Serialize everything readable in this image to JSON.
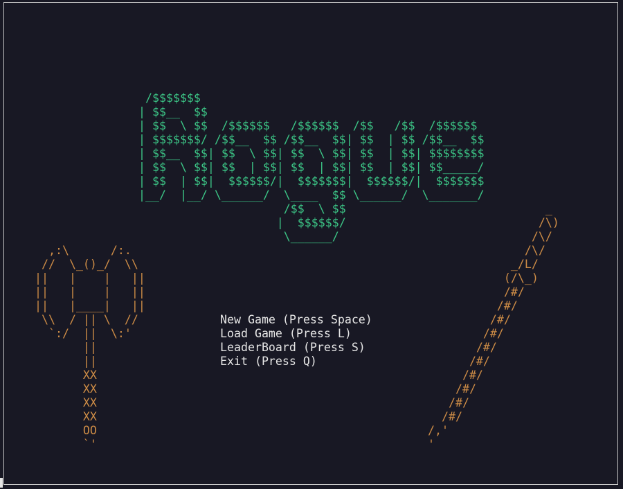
{
  "game": {
    "logo_art": " /$$$$$$$\n| $$__  $$\n| $$  \\ $$  /$$$$$$   /$$$$$$  /$$   /$$  /$$$$$$\n| $$$$$$$/ /$$__  $$ /$$__  $$| $$  | $$ /$$__  $$\n| $$__  $$| $$  \\ $$| $$  \\ $$| $$  | $$| $$$$$$$$\n| $$  \\ $$| $$  | $$| $$  | $$| $$  | $$| $$_____/\n| $$  | $$|  $$$$$$/|  $$$$$$$|  $$$$$$/|  $$$$$$$\n|__/  |__/ \\______/  \\____  $$ \\______/  \\_______/\n                     /$$  \\ $$\n                    |  $$$$$$/\n                     \\______/",
    "axe_art": "  ,:\\      /:.\n //  \\_()_/  \\\\\n||   |    |   ||\n||   |    |   ||\n||   |____|   ||\n \\\\  / || \\  //\n  `:/  ||  \\:'\n       ||\n       ||\n       XX\n       XX\n       XX\n       XX\n       OO\n       `'",
    "staff_art": "                 _\n                /\\)\n               /\\/\n              /\\/\n            _/L/\n           (/\\_)\n           /#/\n          /#/\n         /#/\n        /#/\n       /#/\n      /#/\n     /#/\n    /#/\n   /#/\n  /#/\n/,'\n'",
    "menu": [
      "New Game (Press Space)",
      "Load Game (Press L)",
      "LeaderBoard (Press S)",
      "Exit (Press Q)"
    ],
    "colors": {
      "background": "#181824",
      "logo": "#3cc586",
      "art": "#cd8c46",
      "menu_text": "#e6e6e6",
      "border": "#c9c9c9"
    }
  }
}
